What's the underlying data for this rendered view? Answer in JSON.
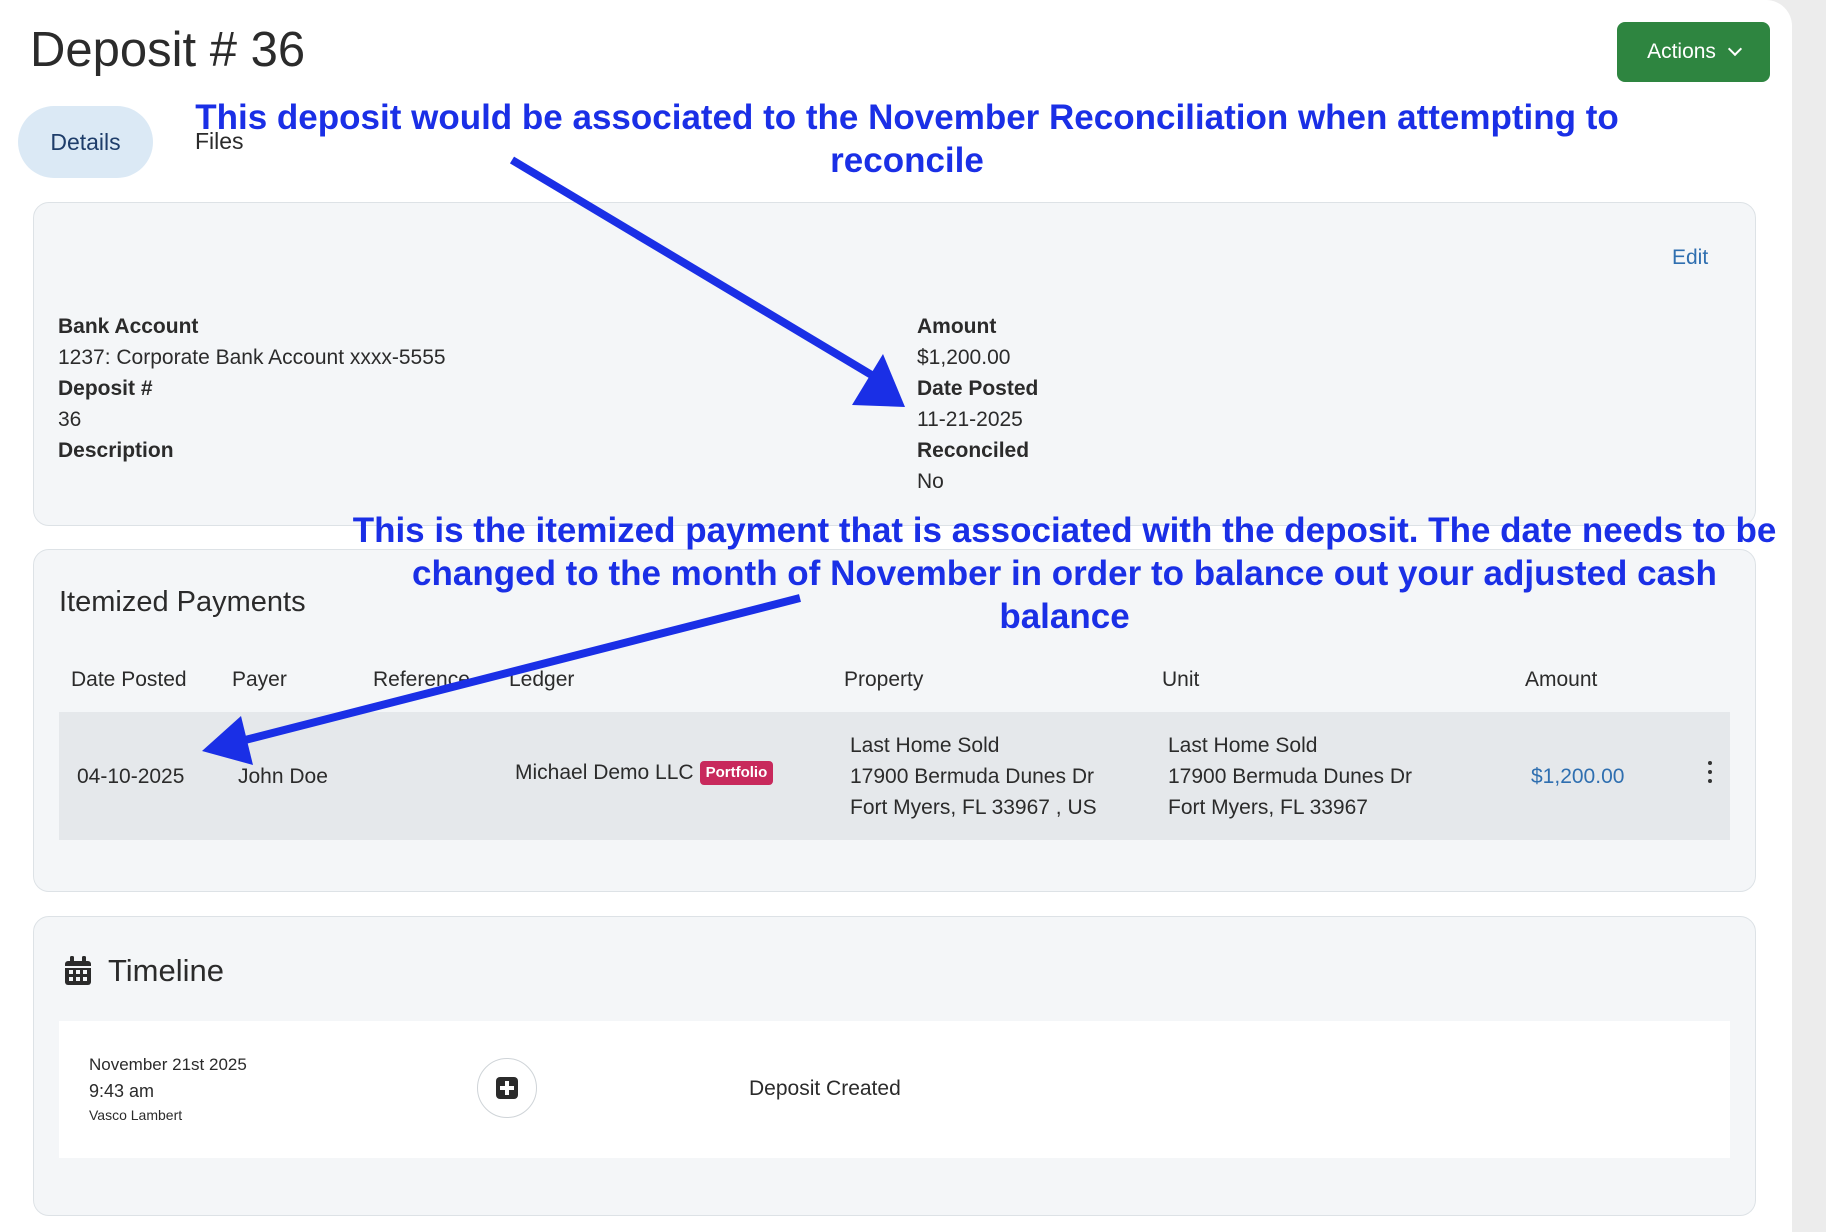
{
  "header": {
    "title": "Deposit # 36",
    "actions_label": "Actions"
  },
  "tabs": [
    {
      "label": "Details",
      "active": true
    },
    {
      "label": "Files",
      "active": false
    }
  ],
  "details": {
    "edit_label": "Edit",
    "bank_account_label": "Bank Account",
    "bank_account_value": "1237: Corporate Bank Account xxxx-5555",
    "deposit_no_label": "Deposit #",
    "deposit_no_value": "36",
    "description_label": "Description",
    "amount_label": "Amount",
    "amount_value": "$1,200.00",
    "date_posted_label": "Date Posted",
    "date_posted_value": "11-21-2025",
    "reconciled_label": "Reconciled",
    "reconciled_value": "No"
  },
  "itemized": {
    "title": "Itemized Payments",
    "columns": [
      "Date Posted",
      "Payer",
      "Reference",
      "Ledger",
      "Property",
      "Unit",
      "Amount"
    ],
    "rows": [
      {
        "date_posted": "04-10-2025",
        "payer": "John Doe",
        "ledger": "Michael Demo LLC",
        "ledger_badge": "Portfolio",
        "property_line1": "Last Home Sold",
        "property_line2": "17900 Bermuda Dunes Dr",
        "property_line3": "Fort Myers, FL 33967 , US",
        "unit_line1": "Last Home Sold",
        "unit_line2": "17900 Bermuda Dunes Dr",
        "unit_line3": "Fort Myers, FL 33967",
        "amount": "$1,200.00"
      }
    ]
  },
  "timeline": {
    "title": "Timeline",
    "entries": [
      {
        "date": "November 21st 2025",
        "time": "9:43 am",
        "user": "Vasco Lambert",
        "event": "Deposit Created"
      }
    ]
  },
  "annotations": {
    "top": "This deposit would be associated to the November Reconciliation when attempting to reconcile",
    "middle": "This is the itemized payment that is associated with the deposit. The date needs to be changed to the month of November in order to balance out your adjusted cash balance"
  },
  "colors": {
    "actions_button": "#2e8540",
    "tab_active_bg": "#dbe9f5",
    "link": "#2f6fb0",
    "badge": "#c8295c",
    "annotation": "#1a2fe6"
  },
  "icons": {
    "actions": "chevron-down-icon",
    "kebab": "more-vertical-icon",
    "timeline": "calendar-icon",
    "timeline_event": "plus-square-icon"
  }
}
